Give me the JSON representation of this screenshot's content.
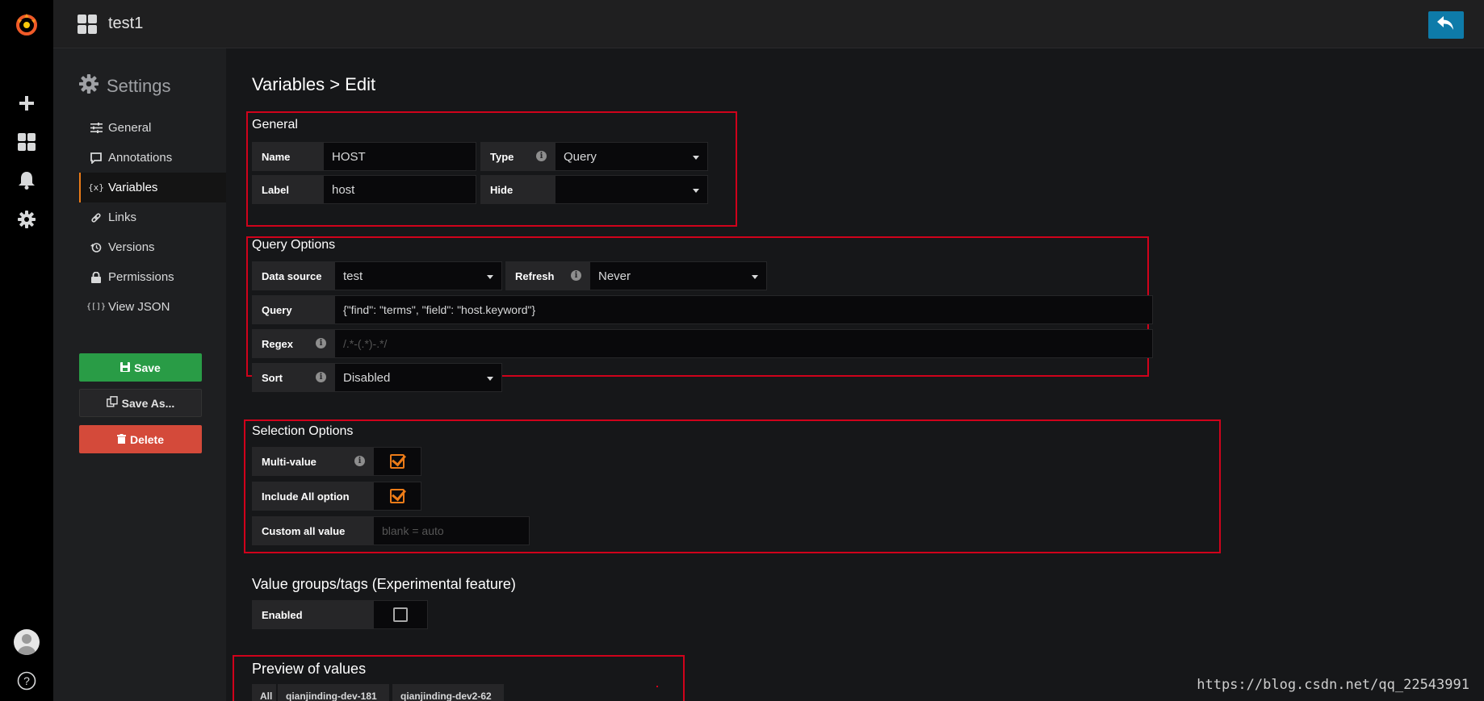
{
  "topbar": {
    "title": "test1"
  },
  "settings": {
    "title": "Settings",
    "menu": [
      {
        "label": "General",
        "icon": "sliders-icon"
      },
      {
        "label": "Annotations",
        "icon": "comment-icon"
      },
      {
        "label": "Variables",
        "icon": "variable-icon",
        "active": true
      },
      {
        "label": "Links",
        "icon": "link-icon"
      },
      {
        "label": "Versions",
        "icon": "history-icon"
      },
      {
        "label": "Permissions",
        "icon": "lock-icon"
      },
      {
        "label": "View JSON",
        "icon": "json-icon"
      }
    ],
    "buttons": {
      "save": "Save",
      "save_as": "Save As...",
      "delete": "Delete"
    }
  },
  "page": {
    "title": "Variables > Edit"
  },
  "general": {
    "title": "General",
    "name_label": "Name",
    "name_value": "HOST",
    "type_label": "Type",
    "type_value": "Query",
    "label_label": "Label",
    "label_value": "host",
    "hide_label": "Hide",
    "hide_value": ""
  },
  "query_options": {
    "title": "Query Options",
    "datasource_label": "Data source",
    "datasource_value": "test",
    "refresh_label": "Refresh",
    "refresh_value": "Never",
    "query_label": "Query",
    "query_value": "{\"find\": \"terms\", \"field\": \"host.keyword\"}",
    "regex_label": "Regex",
    "regex_placeholder": "/.*-(.*)-.*/",
    "sort_label": "Sort",
    "sort_value": "Disabled"
  },
  "selection_options": {
    "title": "Selection Options",
    "multi_label": "Multi-value",
    "multi_checked": true,
    "include_all_label": "Include All option",
    "include_all_checked": true,
    "custom_all_label": "Custom all value",
    "custom_all_placeholder": "blank = auto"
  },
  "value_groups": {
    "title": "Value groups/tags (Experimental feature)",
    "enabled_label": "Enabled",
    "enabled_checked": false
  },
  "preview": {
    "title": "Preview of values",
    "values": [
      "All",
      "qianjinding-dev-181",
      "qianjinding-dev2-62"
    ]
  },
  "watermark": "https://blog.csdn.net/qq_22543991",
  "colors": {
    "accent": "#eb7b18",
    "save": "#299c46",
    "delete": "#d44a3a",
    "highlight_box": "#d0021b",
    "back_button": "#0e7ba9"
  }
}
